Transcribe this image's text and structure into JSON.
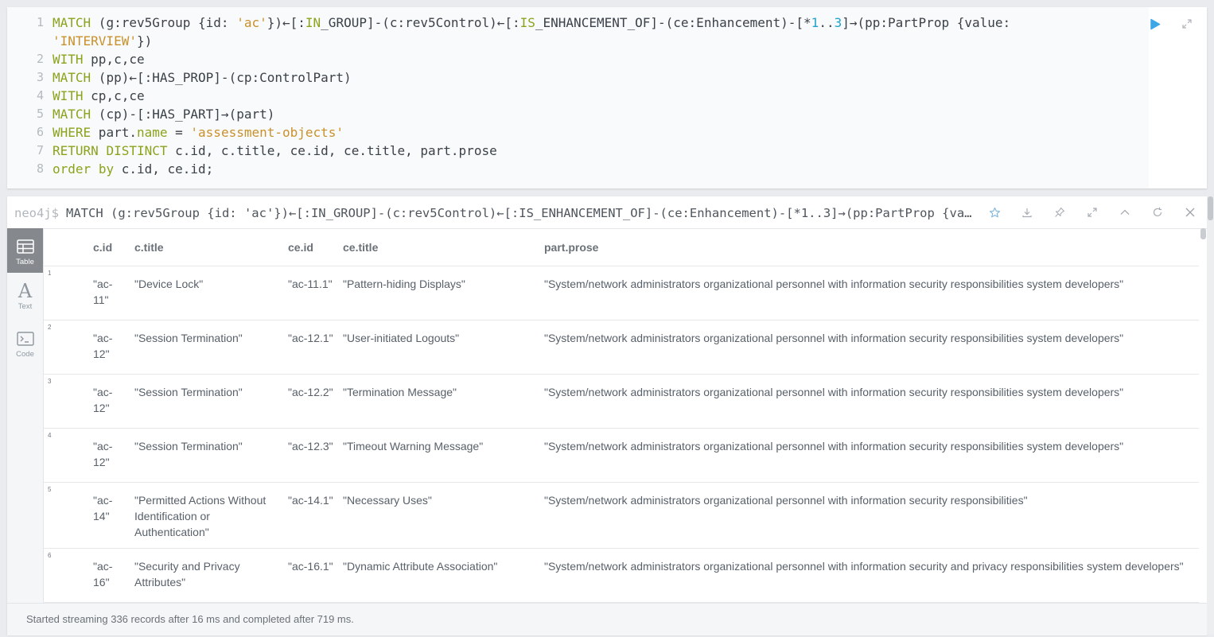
{
  "editor": {
    "lines": [
      {
        "n": "1",
        "tokens": [
          {
            "t": "MATCH",
            "c": "kw"
          },
          {
            "t": " (g:rev5Group {id: "
          },
          {
            "t": "'ac'",
            "c": "str"
          },
          {
            "t": "})←[:"
          },
          {
            "t": "IN",
            "c": "kw"
          },
          {
            "t": "_GROUP]-(c:rev5Control)←[:"
          },
          {
            "t": "IS",
            "c": "kw"
          },
          {
            "t": "_ENHANCEMENT_OF]-(ce:Enhancement)-[*"
          },
          {
            "t": "1",
            "c": "num"
          },
          {
            "t": ".."
          },
          {
            "t": "3",
            "c": "num"
          },
          {
            "t": "]→(pp:PartProp {value:"
          }
        ]
      },
      {
        "n": "",
        "tokens": [
          {
            "t": "'INTERVIEW'",
            "c": "str"
          },
          {
            "t": "})"
          }
        ]
      },
      {
        "n": "2",
        "tokens": [
          {
            "t": "WITH",
            "c": "kw"
          },
          {
            "t": " pp,c,ce"
          }
        ]
      },
      {
        "n": "3",
        "tokens": [
          {
            "t": "MATCH",
            "c": "kw"
          },
          {
            "t": " (pp)←[:HAS_PROP]-(cp:ControlPart)"
          }
        ]
      },
      {
        "n": "4",
        "tokens": [
          {
            "t": "WITH",
            "c": "kw"
          },
          {
            "t": " cp,c,ce"
          }
        ]
      },
      {
        "n": "5",
        "tokens": [
          {
            "t": "MATCH",
            "c": "kw"
          },
          {
            "t": " (cp)-[:HAS_PART]→(part)"
          }
        ]
      },
      {
        "n": "6",
        "tokens": [
          {
            "t": "WHERE",
            "c": "kw"
          },
          {
            "t": " part."
          },
          {
            "t": "name",
            "c": "kw"
          },
          {
            "t": " = "
          },
          {
            "t": "'assessment-objects'",
            "c": "str"
          }
        ]
      },
      {
        "n": "7",
        "tokens": [
          {
            "t": "RETURN",
            "c": "kw"
          },
          {
            "t": " "
          },
          {
            "t": "DISTINCT",
            "c": "kw"
          },
          {
            "t": " c.id, c.title, ce.id, ce.title, part.prose"
          }
        ]
      },
      {
        "n": "8",
        "tokens": [
          {
            "t": "order",
            "c": "kw"
          },
          {
            "t": " "
          },
          {
            "t": "by",
            "c": "kw"
          },
          {
            "t": " c.id, ce.id;"
          }
        ]
      }
    ],
    "icons": [
      "play-icon",
      "expand-icon",
      "close-icon"
    ]
  },
  "frame": {
    "prompt": "neo4j$",
    "command": "MATCH (g:rev5Group {id: 'ac'})←[:IN_GROUP]-(c:rev5Control)←[:IS_ENHANCEMENT_OF]-(ce:Enhancement)-[*1..3]→(pp:PartProp {value: 'INTERVIEW'}) WITH pp,c,ce MATCH (pp)←[:HAS_PROP]-(cp:ControlPart) WITH cp,c,ce MATCH (cp)-[:HAS_PART]→(part) WHERE part.name = 'assessment-objects' RETURN DISTINCT c.id, c.title, ce.id, ce.title, part.prose order by c.id, ce.id;",
    "tools": [
      "star-icon",
      "download-icon",
      "pin-icon",
      "expand-icon",
      "collapse-icon",
      "rerun-icon",
      "close-icon"
    ]
  },
  "views": [
    {
      "label": "Table",
      "icon": "table-icon",
      "active": true
    },
    {
      "label": "Text",
      "icon": "text-icon",
      "active": false
    },
    {
      "label": "Code",
      "icon": "code-icon",
      "active": false
    }
  ],
  "table": {
    "columns": [
      "c.id",
      "c.title",
      "ce.id",
      "ce.title",
      "part.prose"
    ],
    "rows": [
      {
        "n": "1",
        "c_id": "\"ac-11\"",
        "c_title": "\"Device Lock\"",
        "ce_id": "\"ac-11.1\"",
        "ce_title": "\"Pattern-hiding Displays\"",
        "prose": "\"System/network administrators organizational personnel with information security responsibilities system developers\""
      },
      {
        "n": "2",
        "c_id": "\"ac-12\"",
        "c_title": "\"Session Termination\"",
        "ce_id": "\"ac-12.1\"",
        "ce_title": "\"User-initiated Logouts\"",
        "prose": "\"System/network administrators organizational personnel with information security responsibilities system developers\""
      },
      {
        "n": "3",
        "c_id": "\"ac-12\"",
        "c_title": "\"Session Termination\"",
        "ce_id": "\"ac-12.2\"",
        "ce_title": "\"Termination Message\"",
        "prose": "\"System/network administrators organizational personnel with information security responsibilities system developers\""
      },
      {
        "n": "4",
        "c_id": "\"ac-12\"",
        "c_title": "\"Session Termination\"",
        "ce_id": "\"ac-12.3\"",
        "ce_title": "\"Timeout Warning Message\"",
        "prose": "\"System/network administrators organizational personnel with information security responsibilities system developers\""
      },
      {
        "n": "5",
        "c_id": "\"ac-14\"",
        "c_title": "\"Permitted Actions Without Identification or Authentication\"",
        "ce_id": "\"ac-14.1\"",
        "ce_title": "\"Necessary Uses\"",
        "prose": "\"System/network administrators organizational personnel with information security responsibilities\""
      },
      {
        "n": "6",
        "c_id": "\"ac-16\"",
        "c_title": "\"Security and Privacy Attributes\"",
        "ce_id": "\"ac-16.1\"",
        "ce_title": "\"Dynamic Attribute Association\"",
        "prose": "\"System/network administrators organizational personnel with information security and privacy responsibilities system developers\""
      }
    ]
  },
  "status": "Started streaming 336 records after 16 ms and completed after 719 ms.",
  "colors": {
    "keyword": "#8aa31b",
    "string": "#c9912a",
    "number": "#1fa3cc",
    "play": "#3ba7e6"
  }
}
